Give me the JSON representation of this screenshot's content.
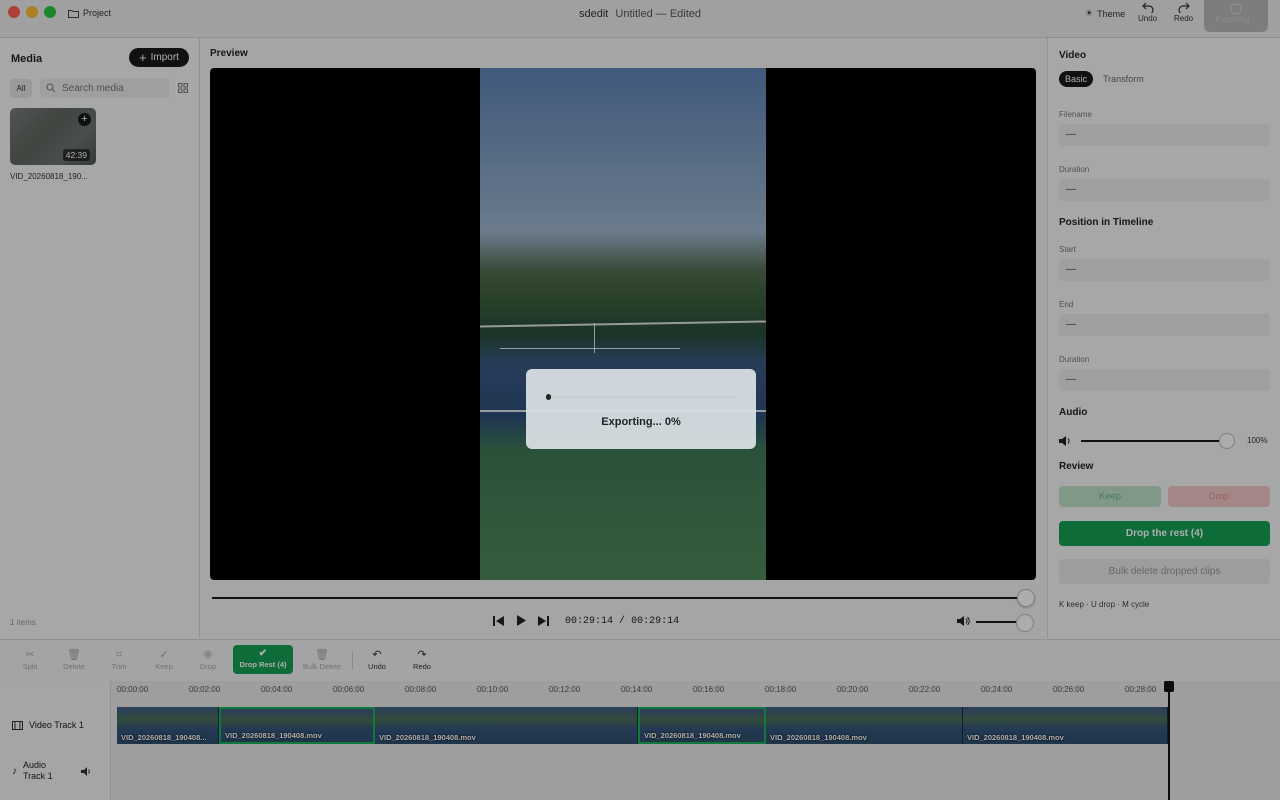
{
  "window": {
    "project_label": "Project",
    "app_name": "sdedit",
    "doc_title": "Untitled — Edited",
    "theme_label": "Theme",
    "undo_label": "Undo",
    "redo_label": "Redo",
    "exporting_label": "Exporting..."
  },
  "media": {
    "title": "Media",
    "import_label": "Import",
    "filter_all": "All",
    "search_placeholder": "Search media",
    "items": [
      {
        "name": "VID_20260818_190...",
        "duration": "42:39"
      }
    ],
    "count": "1 items"
  },
  "preview": {
    "title": "Preview",
    "export_text": "Exporting... 0%",
    "export_progress": 0,
    "current_time": "00:29:14",
    "separator": "/",
    "total_time": "00:29:14",
    "scrub_position": 1.0,
    "volume": 1.0
  },
  "inspector": {
    "video_title": "Video",
    "tabs": [
      "Basic",
      "Transform"
    ],
    "filename_label": "Filename",
    "filename_value": "—",
    "duration_label": "Duration",
    "duration_value": "—",
    "position_title": "Position in Timeline",
    "start_label": "Start",
    "start_value": "—",
    "end_label": "End",
    "end_value": "—",
    "pos_duration_label": "Duration",
    "pos_duration_value": "—",
    "audio_title": "Audio",
    "audio_percent": "100%",
    "audio_level": 1.0,
    "review_title": "Review",
    "keep_label": "Keep",
    "drop_label": "Drop",
    "drop_rest_label": "Drop the rest (4)",
    "bulk_delete_label": "Bulk delete dropped clips",
    "hint": "K keep · U drop · M cycle"
  },
  "toolbar": {
    "split": "Split",
    "delete": "Delete",
    "trim": "Trim",
    "keep": "Keep",
    "drop": "Drop",
    "drop_rest": "Drop Rest (4)",
    "bulk_delete": "Bulk Delete",
    "undo": "Undo",
    "redo": "Redo"
  },
  "timeline": {
    "video_track_label": "Video Track 1",
    "audio_track_label": "Audio Track 1",
    "ticks": [
      "00:00:00",
      "00:02:00",
      "00:04:00",
      "00:06:00",
      "00:08:00",
      "00:10:00",
      "00:12:00",
      "00:14:00",
      "00:16:00",
      "00:18:00",
      "00:20:00",
      "00:22:00",
      "00:24:00",
      "00:26:00",
      "00:28:00"
    ],
    "clips": [
      {
        "name": "VID_20260818_190408...",
        "selected": false
      },
      {
        "name": "VID_20260818_190408.mov",
        "selected": true
      },
      {
        "name": "VID_20260818_190408.mov",
        "selected": false
      },
      {
        "name": "VID_20260818_190408.mov",
        "selected": true
      },
      {
        "name": "VID_20260818_190408.mov",
        "selected": false
      },
      {
        "name": "VID_20260818_190408.mov",
        "selected": false
      }
    ]
  },
  "colors": {
    "accent_green": "#14a052",
    "selected_clip_border": "#18b35a",
    "keep_bg": "#bfe1c8",
    "drop_bg": "#f1c8c8"
  }
}
